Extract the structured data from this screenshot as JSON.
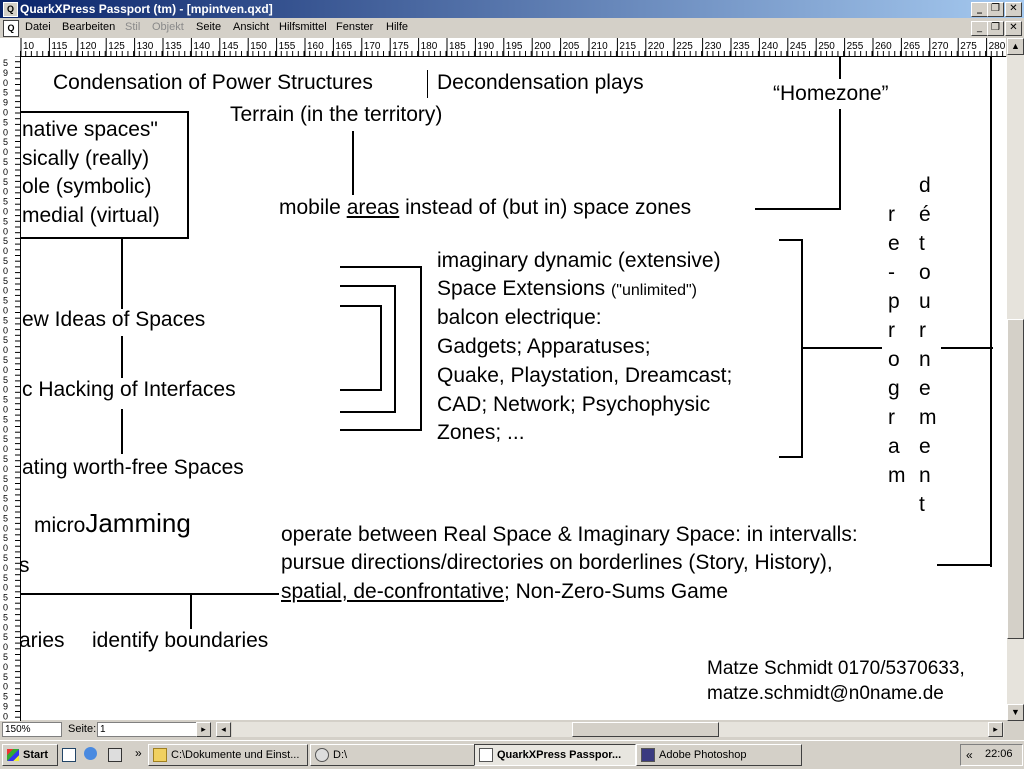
{
  "window": {
    "title": "QuarkXPress Passport (tm) - [mpintven.qxd]",
    "app_icon": "quark-icon"
  },
  "menu": {
    "items": [
      "Datei",
      "Bearbeiten",
      "Stil",
      "Objekt",
      "Seite",
      "Ansicht",
      "Hilfsmittel",
      "Fenster",
      "Hilfe"
    ],
    "disabled": [
      "Stil",
      "Objekt"
    ]
  },
  "ruler": {
    "h_labels": [
      "10",
      "115",
      "120",
      "125",
      "130",
      "135",
      "140",
      "145",
      "150",
      "155",
      "160",
      "165",
      "170",
      "175",
      "180",
      "185",
      "190",
      "195",
      "200",
      "205",
      "210",
      "215",
      "220",
      "225",
      "230",
      "235",
      "240",
      "245",
      "250",
      "255",
      "260",
      "265",
      "270",
      "275",
      "280"
    ]
  },
  "doc": {
    "condensation": "Condensation of Power Structures",
    "decondensation": "Decondensation plays",
    "terrain": "Terrain (in the territory)",
    "homezone": "“Homezone”",
    "mobile_pre": "mobile ",
    "mobile_areas": "areas",
    "mobile_post": " instead of (but in) space zones",
    "box_line1": "native spaces\"",
    "box_line2": "sically (really)",
    "box_line3": "ole (symbolic)",
    "box_line4": "medial (virtual)",
    "new_ideas": "ew Ideas of Spaces",
    "hacking": "c Hacking of Interfaces",
    "worth_free": "ating worth-free Spaces",
    "micro_small": "micro",
    "micro_big": "Jamming",
    "s_frag": "s",
    "aries_frag": "aries",
    "identify": "identify boundaries",
    "list": [
      "imaginary dynamic (extensive)",
      "Space Extensions",
      "balcon electrique:",
      "Gadgets; Apparatuses;",
      "Quake, Playstation, Dreamcast;",
      "CAD; Network; Psychophysic",
      "Zones; ..."
    ],
    "unlimited": "(\"unlimited\")",
    "reprogram": "re-program",
    "detournement": "détournement",
    "operate1": "operate between Real Space & Imaginary Space: in intervalls:",
    "operate2": "pursue directions/directories on borderlines (Story, History),",
    "operate3_u": "spatial, de-confrontative",
    "operate3_rest": "; Non-Zero-Sums Game",
    "contact1": "Matze Schmidt 0170/5370633,",
    "contact2": "matze.schmidt@n0name.de"
  },
  "status": {
    "zoom": "150%",
    "page_label": "Seite:",
    "page_value": "1"
  },
  "taskbar": {
    "start": "Start",
    "more": "»",
    "buttons": [
      "C:\\Dokumente und Einst...",
      "D:\\",
      "QuarkXPress Passpor...",
      "Adobe Photoshop"
    ],
    "tray_more": "«",
    "clock": "22:06"
  }
}
